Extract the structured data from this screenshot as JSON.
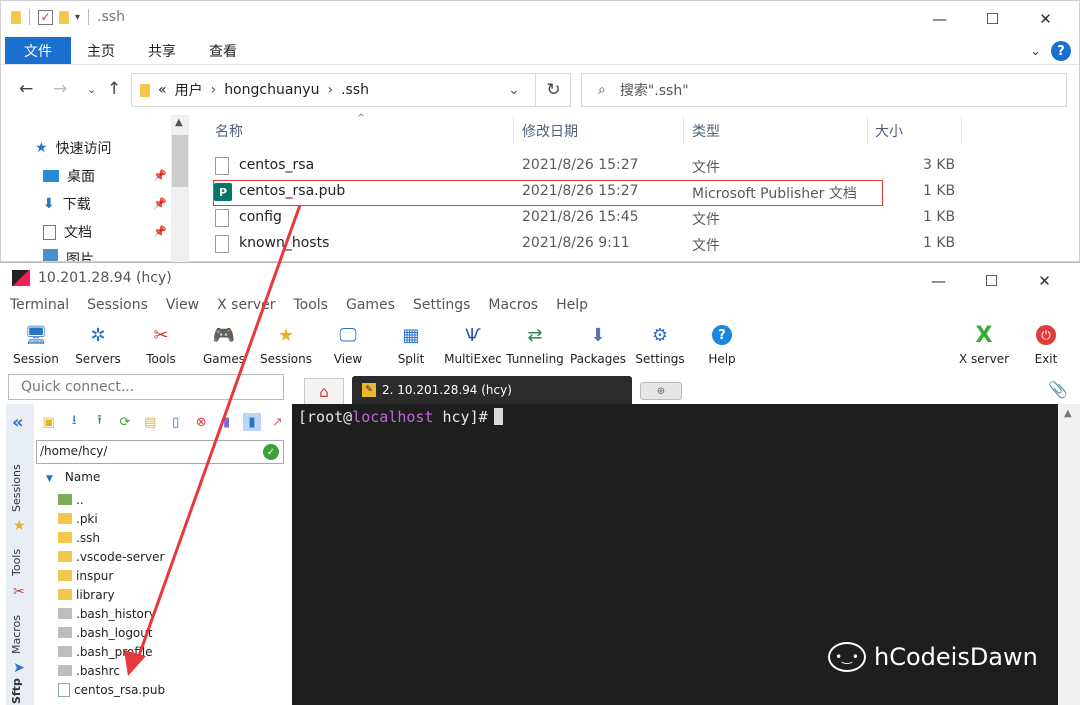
{
  "explorer": {
    "title": ".ssh",
    "ribbon_tabs": [
      "文件",
      "主页",
      "共享",
      "查看"
    ],
    "breadcrumb": [
      "«",
      "用户",
      "hongchuanyu",
      ".ssh"
    ],
    "search_placeholder": "搜索\".ssh\"",
    "nav_items": [
      {
        "label": "快速访问",
        "icon": "star-icon"
      },
      {
        "label": "桌面",
        "icon": "desktop-icon"
      },
      {
        "label": "下载",
        "icon": "download-icon"
      },
      {
        "label": "文档",
        "icon": "document-icon"
      },
      {
        "label": "图片",
        "icon": "picture-icon"
      }
    ],
    "columns": [
      "名称",
      "修改日期",
      "类型",
      "大小"
    ],
    "files": [
      {
        "name": "centos_rsa",
        "date": "2021/8/26 15:27",
        "type": "文件",
        "size": "3 KB"
      },
      {
        "name": "centos_rsa.pub",
        "date": "2021/8/26 15:27",
        "type": "Microsoft Publisher 文档",
        "size": "1 KB"
      },
      {
        "name": "config",
        "date": "2021/8/26 15:45",
        "type": "文件",
        "size": "1 KB"
      },
      {
        "name": "known_hosts",
        "date": "2021/8/26 9:11",
        "type": "文件",
        "size": "1 KB"
      }
    ]
  },
  "moba": {
    "title": "10.201.28.94 (hcy)",
    "menu": [
      "Terminal",
      "Sessions",
      "View",
      "X server",
      "Tools",
      "Games",
      "Settings",
      "Macros",
      "Help"
    ],
    "toolbar": [
      {
        "label": "Session"
      },
      {
        "label": "Servers"
      },
      {
        "label": "Tools"
      },
      {
        "label": "Games"
      },
      {
        "label": "Sessions"
      },
      {
        "label": "View"
      },
      {
        "label": "Split"
      },
      {
        "label": "MultiExec"
      },
      {
        "label": "Tunneling"
      },
      {
        "label": "Packages"
      },
      {
        "label": "Settings"
      },
      {
        "label": "Help"
      }
    ],
    "toolbar_right": [
      {
        "label": "X server"
      },
      {
        "label": "Exit"
      }
    ],
    "quick_connect_placeholder": "Quick connect...",
    "active_tab": "2. 10.201.28.94 (hcy)",
    "side_labels": [
      "Sessions",
      "Tools",
      "Macros",
      "Sftp"
    ],
    "sftp_path": "/home/hcy/",
    "tree_header": "Name",
    "tree_items": [
      {
        "name": "..",
        "kind": "up"
      },
      {
        "name": ".pki",
        "kind": "dir"
      },
      {
        "name": ".ssh",
        "kind": "dir"
      },
      {
        "name": ".vscode-server",
        "kind": "dir"
      },
      {
        "name": "inspur",
        "kind": "dir"
      },
      {
        "name": "library",
        "kind": "dir"
      },
      {
        "name": ".bash_history",
        "kind": "file"
      },
      {
        "name": ".bash_logout",
        "kind": "file"
      },
      {
        "name": ".bash_profile",
        "kind": "file"
      },
      {
        "name": ".bashrc",
        "kind": "file"
      },
      {
        "name": "centos_rsa.pub",
        "kind": "pub"
      }
    ],
    "terminal": {
      "prompt_open": "[root@",
      "host": "localhost",
      "prompt_rest": " hcy]#"
    }
  },
  "watermark": "hCodeisDawn",
  "colors": {
    "accent": "#1a6fcf",
    "annotation_red": "#e03a3a",
    "terminal_bg": "#1e1e1e",
    "prompt_host": "#c266d8"
  }
}
